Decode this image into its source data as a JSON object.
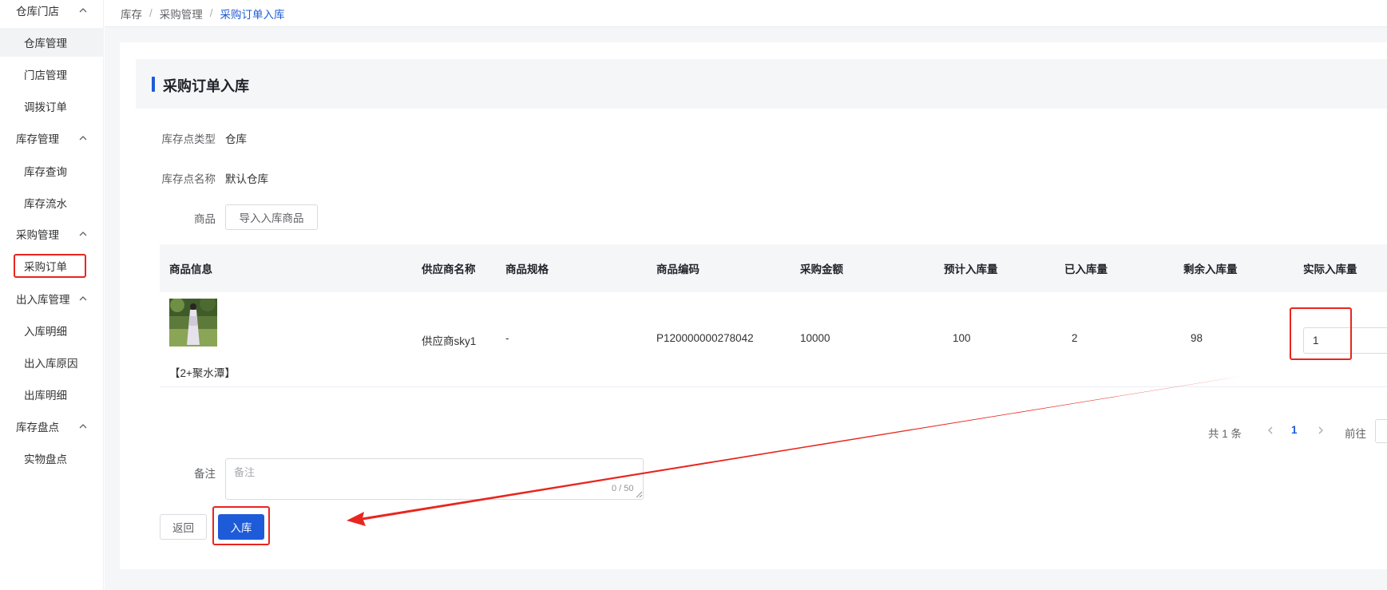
{
  "sidebar": {
    "groups": [
      {
        "label": "仓库门店",
        "items": [
          {
            "label": "仓库管理"
          },
          {
            "label": "门店管理"
          },
          {
            "label": "调拨订单"
          }
        ]
      },
      {
        "label": "库存管理",
        "items": [
          {
            "label": "库存查询"
          },
          {
            "label": "库存流水"
          }
        ]
      },
      {
        "label": "采购管理",
        "items": [
          {
            "label": "采购订单"
          }
        ]
      },
      {
        "label": "出入库管理",
        "items": [
          {
            "label": "入库明细"
          },
          {
            "label": "出入库原因"
          },
          {
            "label": "出库明细"
          }
        ]
      },
      {
        "label": "库存盘点",
        "items": [
          {
            "label": "实物盘点"
          }
        ]
      }
    ]
  },
  "breadcrumb": [
    "库存",
    "采购管理",
    "采购订单入库"
  ],
  "page": {
    "title": "采购订单入库"
  },
  "form": {
    "type_label": "库存点类型",
    "type_value": "仓库",
    "name_label": "库存点名称",
    "name_value": "默认仓库",
    "goods_label": "商品",
    "import_button": "导入入库商品",
    "remark_label": "备注",
    "remark_placeholder": "备注",
    "remark_counter": "0 / 50"
  },
  "table": {
    "columns": [
      "商品信息",
      "供应商名称",
      "商品规格",
      "商品编码",
      "采购金额",
      "预计入库量",
      "已入库量",
      "剩余入库量",
      "实际入库量"
    ],
    "rows": [
      {
        "product_name": "【2+聚水潭】",
        "supplier": "供应商sky1",
        "spec": "-",
        "code": "P120000000278042",
        "amount": "10000",
        "expected_qty": "100",
        "received_qty": "2",
        "remaining_qty": "98",
        "actual_qty": "1"
      }
    ]
  },
  "pagination": {
    "total_text": "共 1 条",
    "current_page": "1",
    "goto_label": "前往"
  },
  "actions": {
    "back_label": "返回",
    "submit_label": "入库"
  },
  "colors": {
    "primary": "#1e5bd8",
    "annotation_red": "#e8261e"
  }
}
